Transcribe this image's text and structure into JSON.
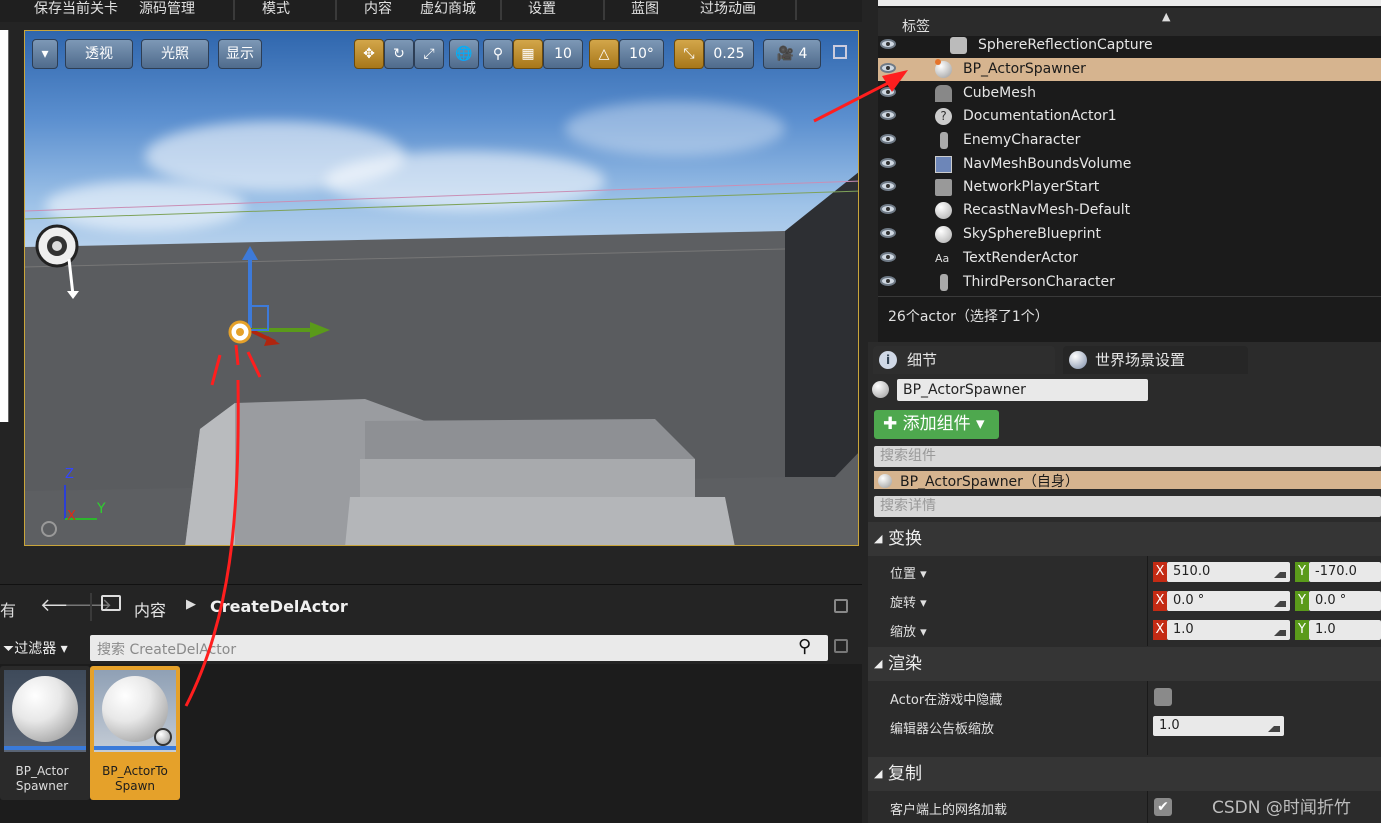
{
  "toolbar": {
    "items": [
      "保存当前关卡",
      "源码管理",
      "模式",
      "内容",
      "虚幻商城",
      "设置",
      "蓝图",
      "过场动画"
    ]
  },
  "viewport": {
    "view_mode": "透视",
    "lighting": "光照",
    "show": "显示",
    "grid_snap": "10",
    "rot_snap": "10°",
    "scale_snap": "0.25",
    "camera_speed": "4",
    "axis_y": "Y",
    "axis_x": "X",
    "axis_z": "Z"
  },
  "content_browser": {
    "back_label": "有",
    "breadcrumb_root": "内容",
    "breadcrumb_current": "CreateDelActor",
    "filter_label": "过滤器",
    "search_placeholder": "搜索 CreateDelActor",
    "assets": [
      {
        "name": "BP_Actor Spawner",
        "selected": false
      },
      {
        "name": "BP_ActorTo Spawn",
        "selected": true
      }
    ]
  },
  "outliner": {
    "column_label": "标签",
    "rows": [
      {
        "label": "SphereReflectionCapture",
        "icon": "sphere-reflection-icon",
        "selected": false
      },
      {
        "label": "BP_ActorSpawner",
        "icon": "blueprint-sphere-icon",
        "selected": true
      },
      {
        "label": "CubeMesh",
        "icon": "mesh-icon",
        "selected": false
      },
      {
        "label": "DocumentationActor1",
        "icon": "documentation-icon",
        "selected": false
      },
      {
        "label": "EnemyCharacter",
        "icon": "character-icon",
        "selected": false
      },
      {
        "label": "NavMeshBoundsVolume",
        "icon": "volume-icon",
        "selected": false
      },
      {
        "label": "NetworkPlayerStart",
        "icon": "player-start-icon",
        "selected": false
      },
      {
        "label": "RecastNavMesh-Default",
        "icon": "sphere-icon",
        "selected": false
      },
      {
        "label": "SkySphereBlueprint",
        "icon": "sphere-icon",
        "selected": false
      },
      {
        "label": "TextRenderActor",
        "icon": "text-render-icon",
        "selected": false
      },
      {
        "label": "ThirdPersonCharacter",
        "icon": "character-icon",
        "selected": false
      }
    ],
    "footer": "26个actor（选择了1个）"
  },
  "details": {
    "tab_details": "细节",
    "tab_world": "世界场景设置",
    "actor_name": "BP_ActorSpawner",
    "add_component": "添加组件",
    "search_components": "搜索组件",
    "component_root": "BP_ActorSpawner（自身）",
    "search_details": "搜索详情",
    "transform": {
      "header": "变换",
      "location_label": "位置",
      "rotation_label": "旋转",
      "scale_label": "缩放",
      "location_x": "510.0",
      "location_y": "-170.0",
      "rotation_x": "0.0 °",
      "rotation_y": "0.0 °",
      "scale_x": "1.0",
      "scale_y": "1.0"
    },
    "rendering": {
      "header": "渲染",
      "hidden_label": "Actor在游戏中隐藏",
      "hidden_checked": false,
      "billboard_label": "编辑器公告板缩放",
      "billboard_value": "1.0"
    },
    "replication": {
      "header": "复制",
      "net_load_label": "客户端上的网络加载",
      "net_load_checked": true
    }
  },
  "watermark": "CSDN @时闻折竹",
  "colors": {
    "accent_orange": "#e5a12a",
    "selected_row": "#d6b48f",
    "add_component_green": "#4ea84e",
    "axis_x_red": "#c42b14",
    "axis_y_green": "#5a9a1a",
    "annotation_red": "#ff1e1e"
  }
}
